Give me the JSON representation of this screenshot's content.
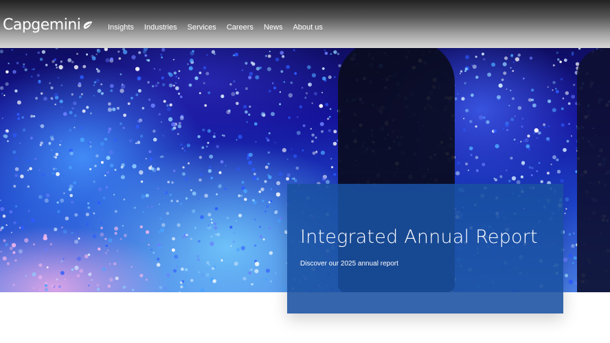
{
  "header": {
    "logo_text": "Capgemini",
    "nav": [
      "Insights",
      "Industries",
      "Services",
      "Careers",
      "News",
      "About us"
    ]
  },
  "hero": {
    "card_title": "Integrated Annual Report",
    "card_subtitle": "Discover our 2025 annual report"
  },
  "colors": {
    "card_bg": "#1950a0",
    "text": "#ffffff"
  },
  "icons": {
    "logo_mark": "spade-logo-icon"
  }
}
